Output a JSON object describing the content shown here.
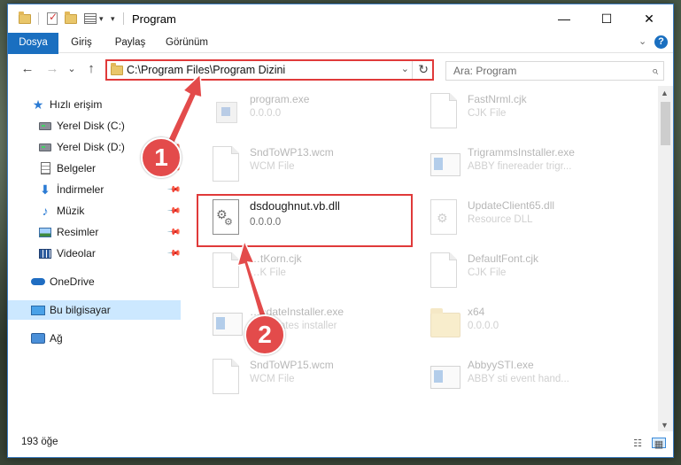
{
  "window": {
    "title": "Program",
    "minimize_glyph": "—",
    "maximize_glyph": "☐",
    "close_glyph": "✕"
  },
  "ribbon": {
    "tabs": [
      {
        "label": "Dosya"
      },
      {
        "label": "Giriş"
      },
      {
        "label": "Paylaş"
      },
      {
        "label": "Görünüm"
      }
    ],
    "expand_glyph": "⌄",
    "help_glyph": "?"
  },
  "navigation": {
    "back_glyph": "←",
    "forward_glyph": "→",
    "recent_glyph": "⌄",
    "up_glyph": "↑",
    "address": "C:\\Program Files\\Program Dizini",
    "address_dropdown_glyph": "⌄",
    "refresh_glyph": "↻",
    "search_placeholder": "Ara: Program",
    "search_glyph": "⌕"
  },
  "sidebar": {
    "items": [
      {
        "label": "Hızlı erişim",
        "icon": "star-icon",
        "pinned": false
      },
      {
        "label": "Yerel Disk (C:)",
        "icon": "drive-icon",
        "pinned": false
      },
      {
        "label": "Yerel Disk (D:)",
        "icon": "drive-icon",
        "pinned": true
      },
      {
        "label": "Belgeler",
        "icon": "document-icon",
        "pinned": true
      },
      {
        "label": "İndirmeler",
        "icon": "download-icon",
        "pinned": true
      },
      {
        "label": "Müzik",
        "icon": "music-icon",
        "pinned": true
      },
      {
        "label": "Resimler",
        "icon": "pictures-icon",
        "pinned": true
      },
      {
        "label": "Videolar",
        "icon": "videos-icon",
        "pinned": true
      },
      {
        "label": "OneDrive",
        "icon": "cloud-icon",
        "pinned": false
      },
      {
        "label": "Bu bilgisayar",
        "icon": "computer-icon",
        "pinned": false,
        "selected": true
      },
      {
        "label": "Ağ",
        "icon": "network-icon",
        "pinned": false
      }
    ],
    "pin_glyph": "📌"
  },
  "files": [
    {
      "name": "program.exe",
      "subtitle": "0.0.0.0",
      "icon": "exe-icon",
      "highlighted": false
    },
    {
      "name": "FastNrml.cjk",
      "subtitle": "CJK File",
      "icon": "file-icon",
      "highlighted": false
    },
    {
      "name": "SndToWP13.wcm",
      "subtitle": "WCM File",
      "icon": "file-icon",
      "highlighted": false
    },
    {
      "name": "TrigrammsInstaller.exe",
      "subtitle": "ABBY finereader trigr...",
      "icon": "installer-icon",
      "highlighted": false
    },
    {
      "name": "dsdoughnut.vb.dll",
      "subtitle": "0.0.0.0",
      "icon": "dll-gear-icon",
      "highlighted": true
    },
    {
      "name": "UpdateClient65.dll",
      "subtitle": "Resource DLL",
      "icon": "dll-gear-icon",
      "highlighted": false
    },
    {
      "name": "…tKorn.cjk",
      "subtitle": "…K File",
      "icon": "file-icon",
      "highlighted": false
    },
    {
      "name": "DefaultFont.cjk",
      "subtitle": "CJK File",
      "icon": "file-icon",
      "highlighted": false
    },
    {
      "name": "…pdateInstaller.exe",
      "subtitle": "… updates installer",
      "icon": "installer-icon",
      "highlighted": false
    },
    {
      "name": "x64",
      "subtitle": "0.0.0.0",
      "icon": "folder-icon",
      "highlighted": false
    },
    {
      "name": "SndToWP15.wcm",
      "subtitle": "WCM File",
      "icon": "file-icon",
      "highlighted": false
    },
    {
      "name": "AbbyySTI.exe",
      "subtitle": "ABBY sti event hand...",
      "icon": "installer-icon",
      "highlighted": false
    }
  ],
  "status": {
    "item_count": "193 öğe",
    "details_view_glyph": "☷",
    "tiles_view_glyph": "▦"
  },
  "callouts": [
    {
      "number": "1",
      "target": "address-bar"
    },
    {
      "number": "2",
      "target": "dsdoughnut.vb.dll"
    }
  ],
  "colors": {
    "accent": "#1a6fc0",
    "highlight": "#e03a3a",
    "callout": "#e34b4b",
    "selection": "#cce8ff"
  }
}
